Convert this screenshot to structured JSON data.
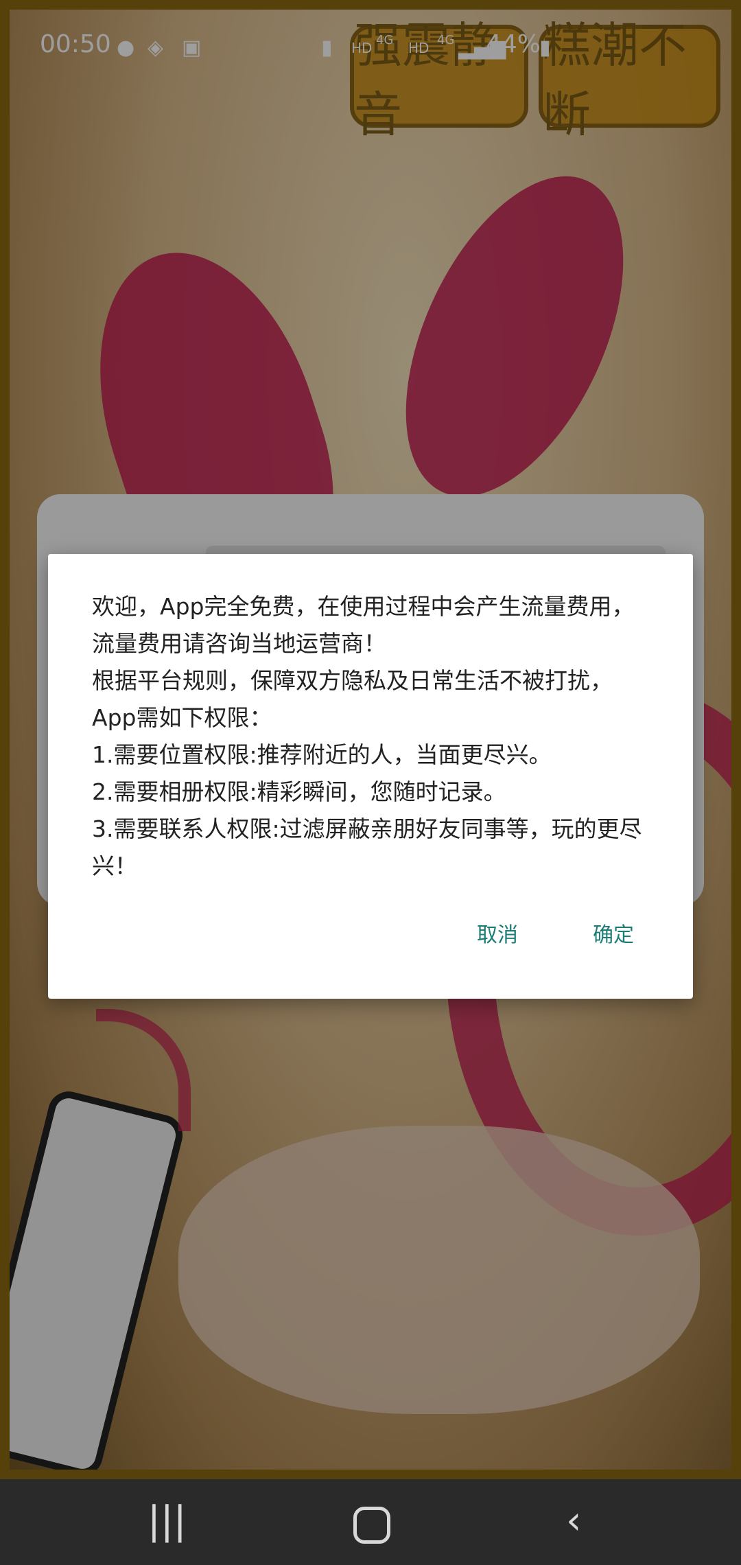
{
  "status_bar": {
    "time": "00:50",
    "signal_left": "HD",
    "signal_right": "HD",
    "network": "4G",
    "battery_percent": "44%"
  },
  "background": {
    "promo_left": "强震静音",
    "promo_right": "糕潮不断"
  },
  "dialog": {
    "lines": [
      "欢迎，App完全免费，在使用过程中会产生流量费用，流量费用请咨询当地运营商！",
      "根据平台规则，保障双方隐私及日常生活不被打扰，App需如下权限：",
      "1.需要位置权限:推荐附近的人，当面更尽兴。",
      "2.需要相册权限:精彩瞬间，您随时记录。",
      "3.需要联系人权限:过滤屏蔽亲朋好友同事等，玩的更尽兴！"
    ],
    "cancel_label": "取消",
    "ok_label": "确定"
  },
  "colors": {
    "accent": "#1b7d75",
    "dialog_bg": "#ffffff",
    "nav_bg": "#2a2a2a"
  }
}
